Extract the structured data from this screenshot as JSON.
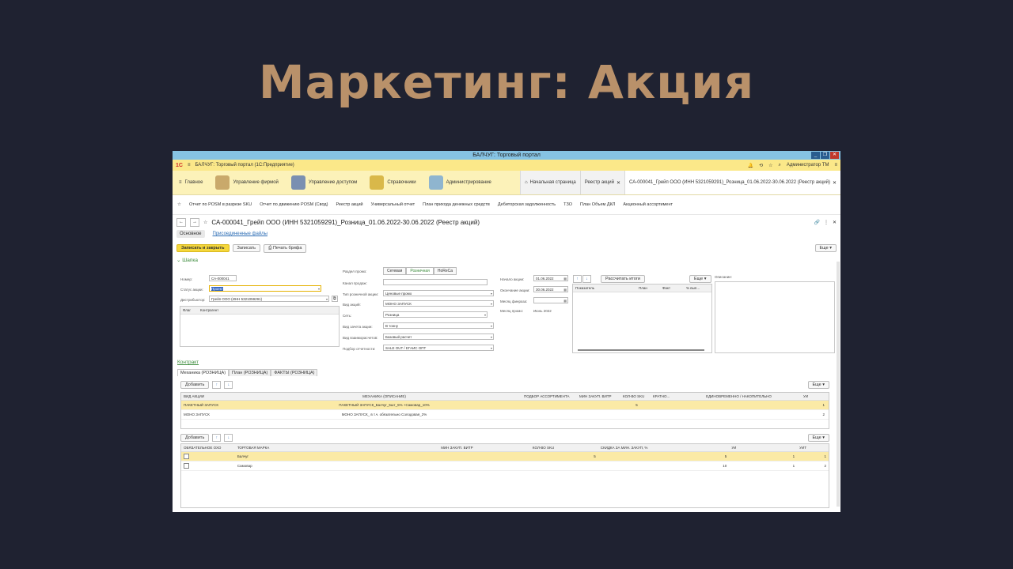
{
  "slide": {
    "title": "Маркетинг: Акция"
  },
  "window": {
    "title": "БАЛЧУГ: Торговый портал"
  },
  "appbar": {
    "logo": "1C",
    "menu_icon": "≡",
    "app_title": "БАЛЧУГ: Торговый портал  (1С:Предприятие)",
    "user": "Администратор ТМ"
  },
  "sections": [
    {
      "label": "Главное"
    },
    {
      "label": "Управление фирмой"
    },
    {
      "label": "Управление доступом"
    },
    {
      "label": "Справочники"
    },
    {
      "label": "Администрирование"
    }
  ],
  "open_tabs": [
    {
      "label": "Начальная страница"
    },
    {
      "label": "Реестр акций"
    },
    {
      "label": "СА-000041_Грейп ООО (ИНН 5321059291)_Розница_01.06.2022-30.06.2022 (Реестр акций)"
    }
  ],
  "command_panel": [
    "Отчет по POSM в разрезе SKU",
    "Отчет по движению POSM (Свод)",
    "Реестр акций",
    "Универсальный отчет",
    "План прихода денежных средств",
    "Дебиторская задолженность",
    "ТЗО",
    "План Объем ДКЛ",
    "Акционный ассортимент"
  ],
  "form": {
    "title": "СА-000041_Грейп ООО (ИНН 5321059291)_Розница_01.06.2022-30.06.2022 (Реестр акций)",
    "tab_main": "Основное",
    "tab_files": "Присоединенные файлы",
    "btn_save_close": "Записать и закрыть",
    "btn_save": "Записать",
    "btn_print": "Печать брифа",
    "btn_more": "Еще",
    "group_header": "Шапка",
    "number_label": "Номер:",
    "number_value": "СА-000041",
    "status_label": "Статус акции:",
    "status_value": "Проект",
    "distributor_label": "Дистрибьютор:",
    "distributor_value": "Грейп ООО (ИНН 5321059291)",
    "flag_col": "Флаг",
    "counterparty_col": "Контрагент",
    "promo_section_label": "Раздел промо:",
    "promo_options": [
      "Сетевая",
      "Розничная",
      "HoReCa"
    ],
    "channel_label": "Канал продаж:",
    "channel_value": "",
    "retail_type_label": "Тип розничной акции:",
    "retail_type_value": "Ценовые промо",
    "action_type_label": "Вид акций:",
    "action_type_value": "МОНО ЗАПУСК",
    "net_label": "Сеть:",
    "net_value": "Розница",
    "credit_label": "Вид зачета акции:",
    "credit_value": "В тонну",
    "settlement_label": "Вид взаиморасчетов:",
    "settlement_value": "Базовый расчет",
    "report_label": "Подбор отчетности:",
    "report_value": "SALE OUT / ЕГАИС ОПТ",
    "start_label": "Начало акции:",
    "start_value": "01.06.2022",
    "end_label": "Окончание акции:",
    "end_value": "30.06.2022",
    "finmonth_label": "Месяц финраза:",
    "finmonth_value": "",
    "promomonth_label": "Месяц промо:",
    "promomonth_value": "Июнь 2022",
    "btn_calc": "Рассчитать итоги",
    "kpi_cols": [
      "Показатель",
      "План",
      "Факт",
      "% вып..."
    ],
    "desc_label": "Описание:",
    "contract_link": "Контракт"
  },
  "mech_tabs": [
    "Механика (РОЗНИЦА)",
    "План (РОЗНИЦА)",
    "ФАКТЫ (РОЗНИЦА)"
  ],
  "mech_table": {
    "add": "Добавить",
    "more": "Еще",
    "headers": [
      "ВИД АКЦИИ",
      "МЕХАНИКА (ОПИСАНИЕ)",
      "ПОДБОР АССОРТИМЕНТА",
      "МИН ЗАКУП. ВИТР",
      "КОЛ-ВО SKU",
      "КРАТНО...",
      "ЕДИНОВРЕМЕННО / НАКОПИТЕЛЬНО",
      "УИ"
    ],
    "rows": [
      [
        "ПАКЕТНЫЙ ЗАПУСК",
        "ПАКЕТНЫЙ ЗАПУСК_Балчуг_5шт_5% +Самовар_10%",
        "",
        "",
        "5",
        "",
        "",
        "1"
      ],
      [
        "МОНО ЗАПУСК",
        "МОНО ЗАПУСК_ в т.ч. обязательно Солодовая_2%",
        "",
        "",
        "",
        "",
        "",
        "2"
      ]
    ]
  },
  "brand_table": {
    "add": "Добавить",
    "more": "Еще",
    "headers": [
      "ОБЯЗАТЕЛЬНОЕ ОХО",
      "ТОРГОВАЯ МАРКА",
      "МИН ЗАКУП. ВИТР",
      "КОЛ-ВО SKU",
      "СКИДКА ЗА МИН. ЗАКУП, %",
      "УИ",
      "УИТ"
    ],
    "rows": [
      [
        "",
        "Балчуг",
        "",
        "5",
        "5",
        "1",
        "1"
      ],
      [
        "",
        "Самовар",
        "",
        "",
        "10",
        "1",
        "2"
      ]
    ]
  },
  "colors": {
    "accent_yellow": "#f5d73b",
    "title_color": "#b9916a",
    "bg": "#1f2231"
  }
}
